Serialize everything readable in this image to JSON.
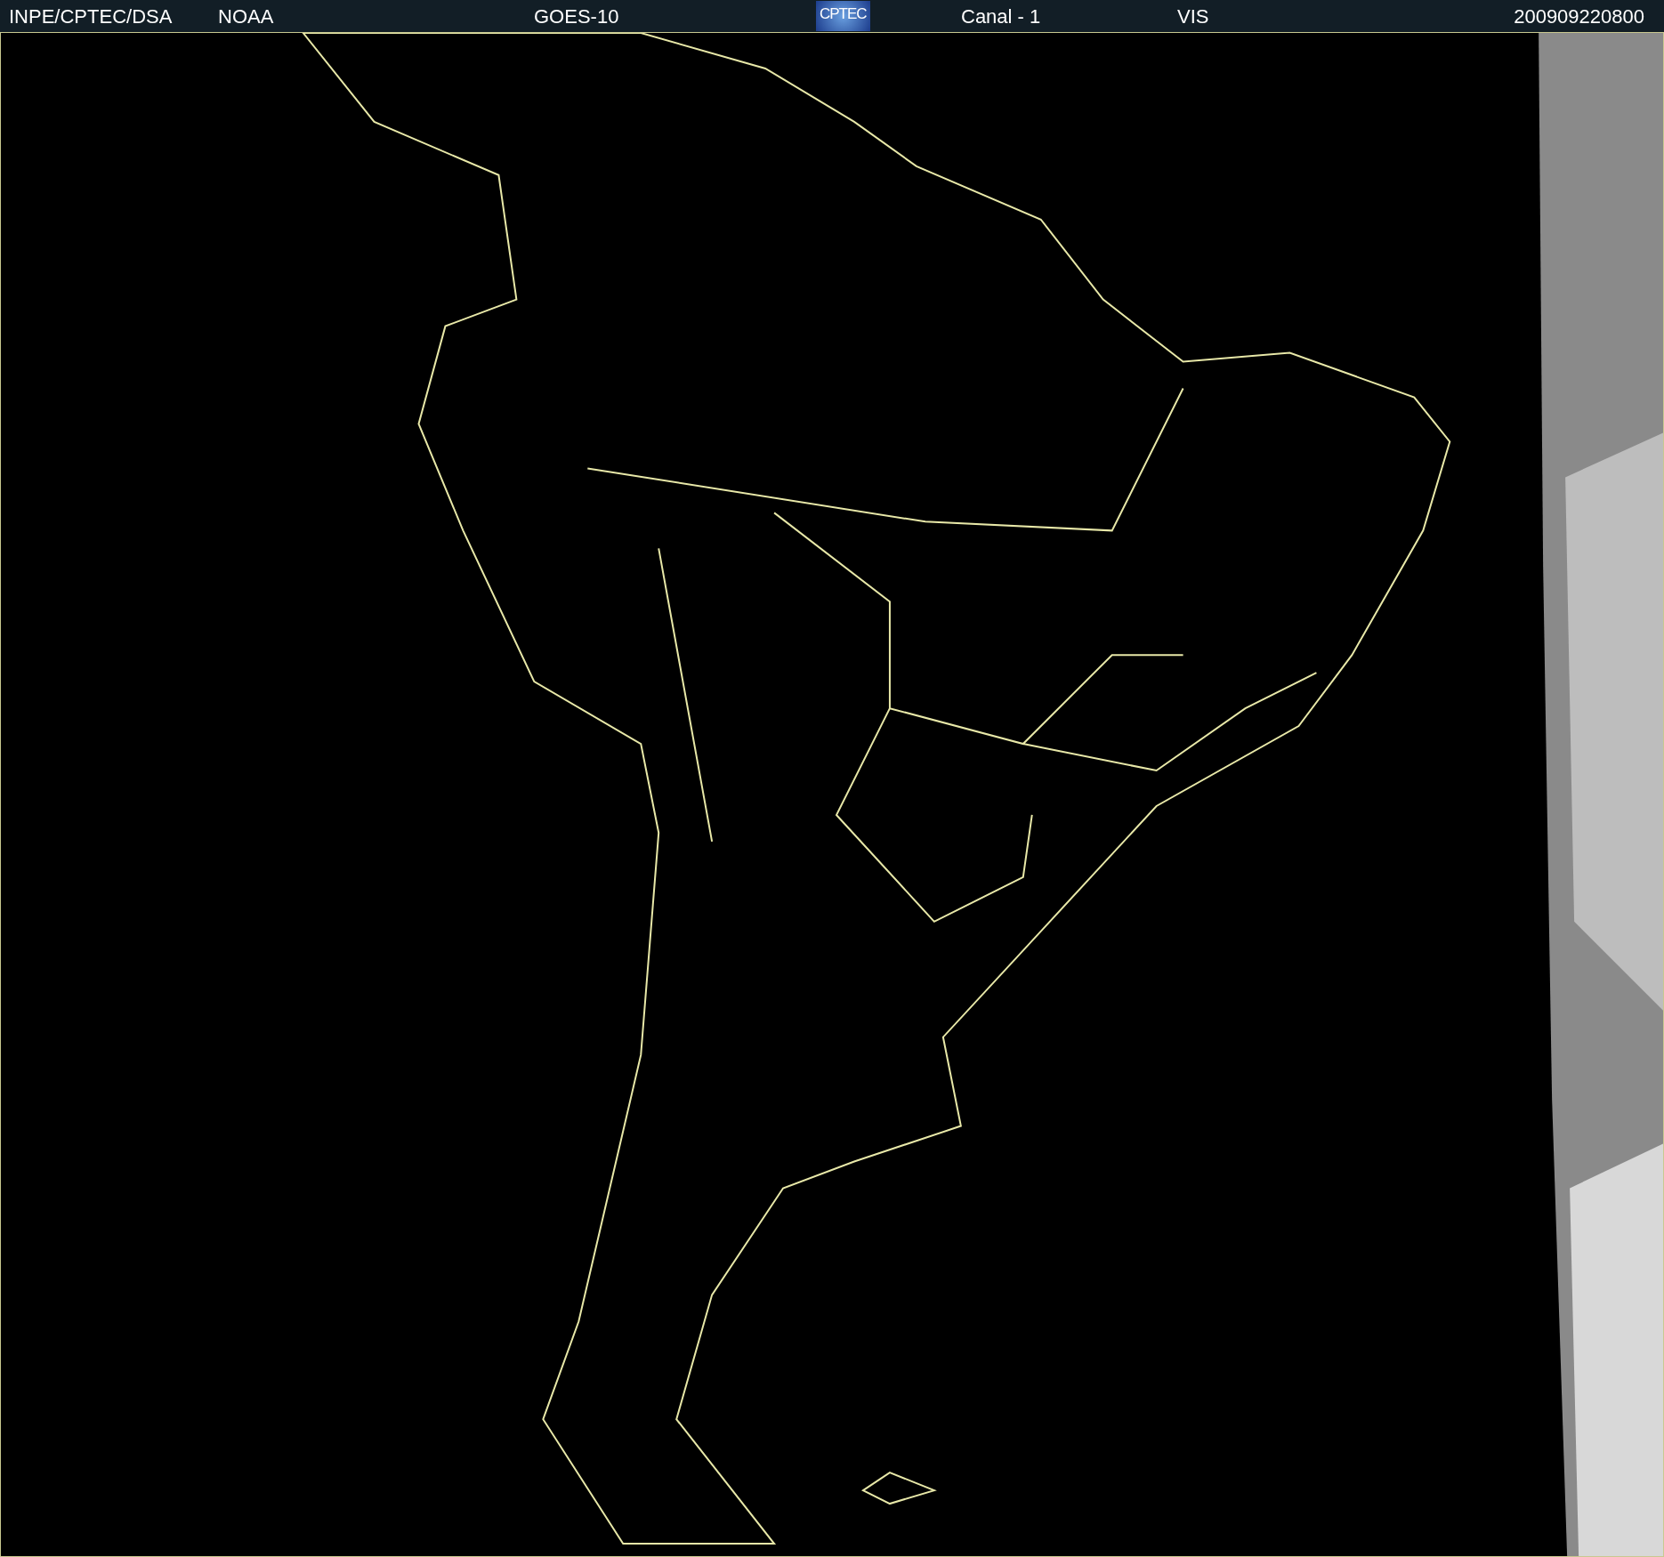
{
  "header": {
    "items": [
      {
        "kind": "text",
        "text": "INPE/CPTEC/DSA"
      },
      {
        "kind": "text",
        "text": "NOAA"
      },
      {
        "kind": "text",
        "text": "GOES-10"
      },
      {
        "kind": "logo",
        "text": "CPTEC"
      },
      {
        "kind": "text",
        "text": "Canal - 1"
      },
      {
        "kind": "text",
        "text": "VIS"
      },
      {
        "kind": "text",
        "text": "200909220800"
      }
    ]
  }
}
